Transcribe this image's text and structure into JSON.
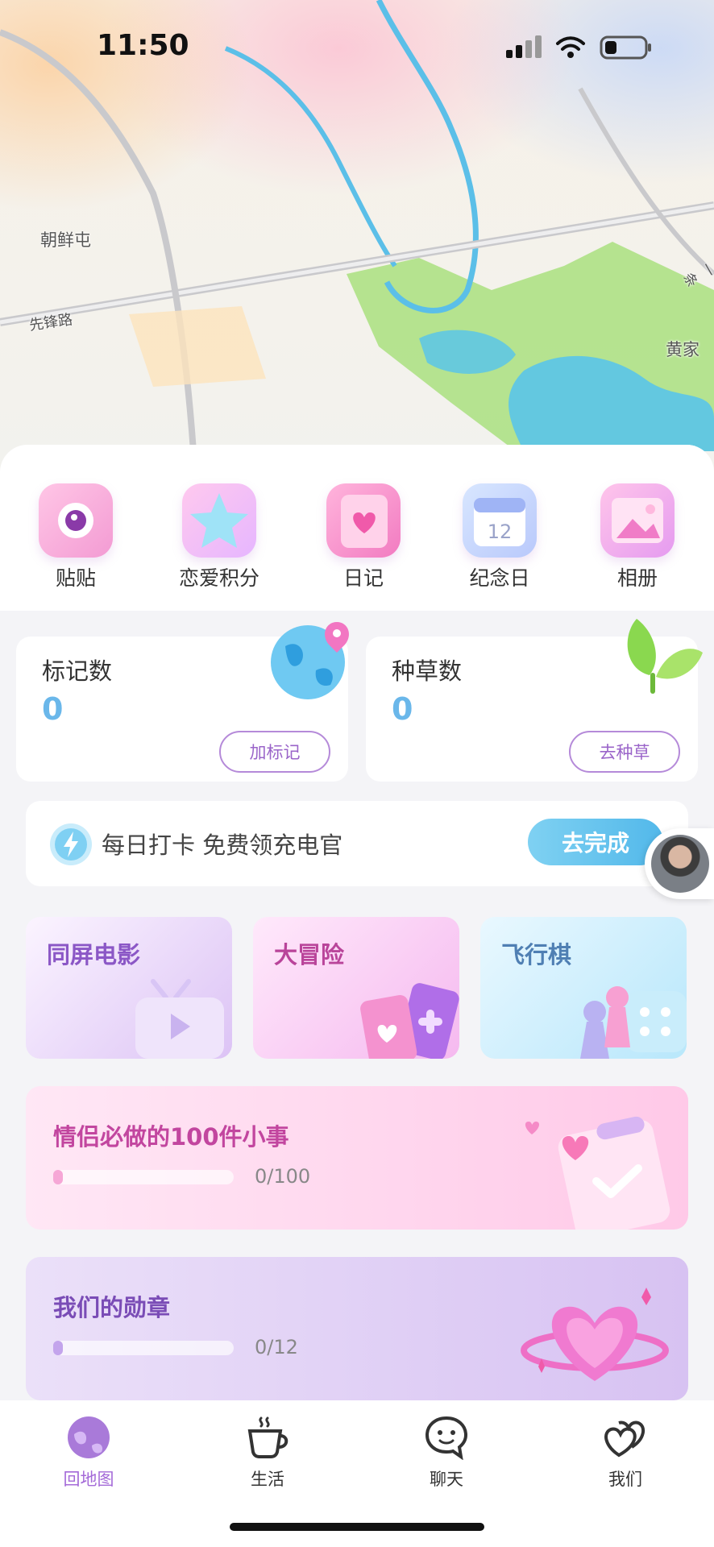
{
  "status_bar": {
    "time": "11:50"
  },
  "map": {
    "labels": [
      "朝鲜屯",
      "先锋路",
      "黄家",
      "一条"
    ]
  },
  "quick_actions": [
    {
      "label": "贴贴",
      "icon": "camera-icon"
    },
    {
      "label": "恋爱积分",
      "icon": "star-icon"
    },
    {
      "label": "日记",
      "icon": "diary-icon"
    },
    {
      "label": "纪念日",
      "icon": "calendar-icon"
    },
    {
      "label": "相册",
      "icon": "photo-album-icon"
    }
  ],
  "stats": {
    "marks": {
      "title": "标记数",
      "value": "0",
      "button": "加标记"
    },
    "plants": {
      "title": "种草数",
      "value": "0",
      "button": "去种草"
    }
  },
  "checkin": {
    "text": "每日打卡 免费领充电官",
    "button": "去完成"
  },
  "games": [
    {
      "title": "同屏电影",
      "icon": "tv-play-icon"
    },
    {
      "title": "大冒险",
      "icon": "cards-icon"
    },
    {
      "title": "飞行棋",
      "icon": "board-game-icon"
    }
  ],
  "progress_cards": [
    {
      "title": "情侣必做的100件小事",
      "count": "0/100",
      "progress": 0
    },
    {
      "title": "我们的勋章",
      "count": "0/12",
      "progress": 0
    }
  ],
  "tabs": [
    {
      "label": "回地图",
      "active": true,
      "icon": "globe-icon"
    },
    {
      "label": "生活",
      "active": false,
      "icon": "coffee-cup-icon"
    },
    {
      "label": "聊天",
      "active": false,
      "icon": "chat-bubble-icon"
    },
    {
      "label": "我们",
      "active": false,
      "icon": "hearts-icon"
    }
  ],
  "colors": {
    "accent": "#a46ad8",
    "stat_value": "#6ab7ea",
    "checkin_button": "#52b8ea"
  }
}
